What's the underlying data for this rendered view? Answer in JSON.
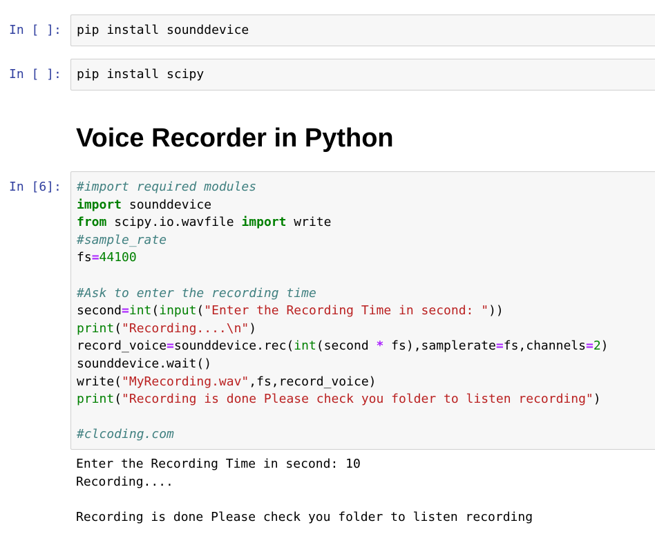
{
  "cells": [
    {
      "prompt": "In [ ]:",
      "code": "pip install sounddevice"
    },
    {
      "prompt": "In [ ]:",
      "code": "pip install scipy"
    }
  ],
  "markdown": {
    "heading": "Voice Recorder in Python"
  },
  "code_cell": {
    "prompt": "In [6]:",
    "tokens": {
      "l1_comment": "#import required modules",
      "l2_import": "import",
      "l2_rest": " sounddevice",
      "l3_from": "from",
      "l3_module": " scipy.io.wavfile ",
      "l3_import": "import",
      "l3_rest": " write",
      "l4_comment": "#sample_rate",
      "l5_name": "fs",
      "l5_eq": "=",
      "l5_num": "44100",
      "l7_comment": "#Ask to enter the recording time",
      "l8_name": "second",
      "l8_eq": "=",
      "l8_int": "int",
      "l8_p1": "(",
      "l8_input": "input",
      "l8_p2": "(",
      "l8_str": "\"Enter the Recording Time in second: \"",
      "l8_p3": "))",
      "l9_print": "print",
      "l9_p1": "(",
      "l9_str": "\"Recording....\\n\"",
      "l9_p2": ")",
      "l10_a": "record_voice",
      "l10_eq": "=",
      "l10_b": "sounddevice.rec(",
      "l10_int": "int",
      "l10_c": "(second ",
      "l10_star": "*",
      "l10_d": " fs),samplerate",
      "l10_eq2": "=",
      "l10_e": "fs,channels",
      "l10_eq3": "=",
      "l10_num": "2",
      "l10_f": ")",
      "l11": "sounddevice.wait()",
      "l12_a": "write(",
      "l12_str": "\"MyRecording.wav\"",
      "l12_b": ",fs,record_voice)",
      "l13_print": "print",
      "l13_p1": "(",
      "l13_str": "\"Recording is done Please check you folder to listen recording\"",
      "l13_p2": ")",
      "l15_comment": "#clcoding.com"
    },
    "output": [
      "Enter the Recording Time in second: 10",
      "Recording....",
      "",
      "Recording is done Please check you folder to listen recording"
    ]
  }
}
